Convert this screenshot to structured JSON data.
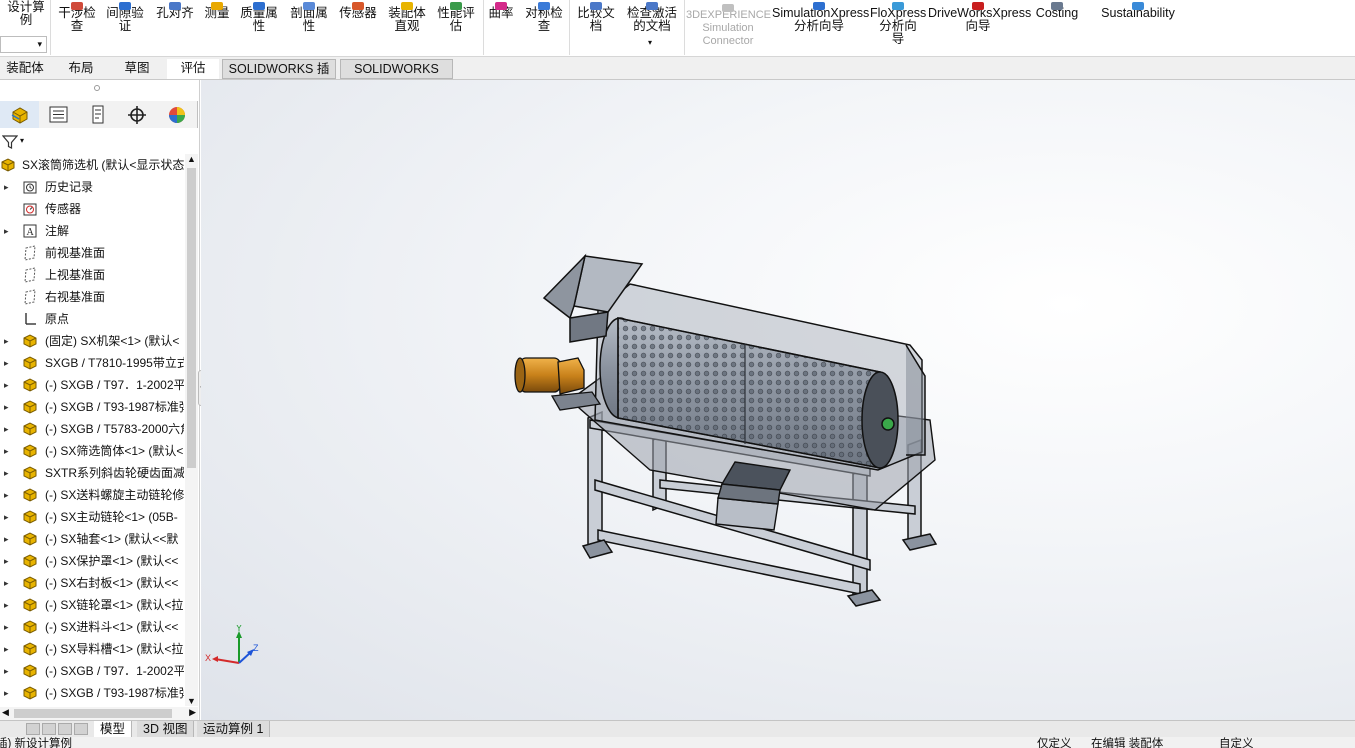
{
  "ribbon": {
    "calc_label": "设计算\n例",
    "buttons": [
      {
        "label": "干涉检\n查"
      },
      {
        "label": "间隙验\n证"
      },
      {
        "label": "孔对齐"
      },
      {
        "label": "测量"
      },
      {
        "label": "质量属\n性"
      },
      {
        "label": "剖面属\n性"
      },
      {
        "label": "传感器"
      },
      {
        "label": "装配体\n直观"
      },
      {
        "label": "性能评\n估"
      },
      {
        "label": "曲率"
      },
      {
        "label": "对称检\n查"
      },
      {
        "label": "比较文\n档"
      },
      {
        "label": "检查激活\n的文档"
      },
      {
        "label": "3DEXPERIENCE\nSimulation\nConnector"
      },
      {
        "label": "SimulationXpress\n分析向导"
      },
      {
        "label": "FloXpress\n分析向\n导"
      },
      {
        "label": "DriveWorksXpress\n向导"
      },
      {
        "label": "Costing"
      },
      {
        "label": "Sustainability"
      }
    ]
  },
  "tabs": [
    "装配体",
    "布局",
    "草图",
    "评估",
    "SOLIDWORKS 插件",
    "SOLIDWORKS MBD"
  ],
  "active_tab": "评估",
  "hud_icons": [
    "zoom-to-fit-icon",
    "zoom-to-area-icon",
    "previous-view-icon",
    "section-view-icon",
    "dynamic-annotation-icon",
    "view-orientation-icon",
    "display-style-icon",
    "hide-show-icon",
    "edit-appearance-icon",
    "scene-icon",
    "view-settings-icon"
  ],
  "feature_tree": {
    "root": "SX滚筒筛选机 (默认<显示状态",
    "items": [
      {
        "label": "历史记录",
        "icon": "history-icon",
        "expandable": true
      },
      {
        "label": "传感器",
        "icon": "sensor-icon",
        "expandable": false
      },
      {
        "label": "注解",
        "icon": "annotation-icon",
        "expandable": true
      },
      {
        "label": "前视基准面",
        "icon": "plane-icon",
        "expandable": false
      },
      {
        "label": "上视基准面",
        "icon": "plane-icon",
        "expandable": false
      },
      {
        "label": "右视基准面",
        "icon": "plane-icon",
        "expandable": false
      },
      {
        "label": "原点",
        "icon": "origin-icon",
        "expandable": false
      },
      {
        "label": "(固定) SX机架<1> (默认<",
        "icon": "part-icon",
        "expandable": true
      },
      {
        "label": "SXGB / T7810-1995带立式",
        "icon": "part-icon",
        "expandable": true
      },
      {
        "label": "(-) SXGB / T97．1-2002平",
        "icon": "part-icon",
        "expandable": true
      },
      {
        "label": "(-) SXGB / T93-1987标准弹",
        "icon": "part-icon",
        "expandable": true
      },
      {
        "label": "(-) SXGB / T5783-2000六角",
        "icon": "part-icon",
        "expandable": true
      },
      {
        "label": "(-) SX筛选筒体<1> (默认<",
        "icon": "part-icon",
        "expandable": true
      },
      {
        "label": "SXTR系列斜齿轮硬齿面减速",
        "icon": "part-icon",
        "expandable": true
      },
      {
        "label": "(-) SX送料螺旋主动链轮修",
        "icon": "part-icon",
        "expandable": true
      },
      {
        "label": "(-) SX主动链轮<1> (05B-",
        "icon": "part-icon",
        "expandable": true
      },
      {
        "label": "(-) SX轴套<1> (默认<<默",
        "icon": "part-icon",
        "expandable": true
      },
      {
        "label": "(-) SX保护罩<1> (默认<<",
        "icon": "part-icon",
        "expandable": true
      },
      {
        "label": "(-) SX右封板<1> (默认<<",
        "icon": "part-icon",
        "expandable": true
      },
      {
        "label": "(-) SX链轮罩<1> (默认<拉",
        "icon": "part-icon",
        "expandable": true
      },
      {
        "label": "(-) SX进料斗<1> (默认<<",
        "icon": "part-icon",
        "expandable": true
      },
      {
        "label": "(-) SX导料槽<1> (默认<拉",
        "icon": "part-icon",
        "expandable": true
      },
      {
        "label": "(-) SXGB / T97．1-2002平",
        "icon": "part-icon",
        "expandable": true
      },
      {
        "label": "(-) SXGB / T93-1987标准弹",
        "icon": "part-icon",
        "expandable": true
      }
    ]
  },
  "triad": {
    "x": "X",
    "y": "Y",
    "z": "Z"
  },
  "bottom_tabs": [
    "模型",
    "3D 视图",
    "运动算例 1"
  ],
  "active_bottom_tab": "模型",
  "status": {
    "left": "插) 新设计算例",
    "s1": "仅定义",
    "s2": "在编辑 装配体",
    "s3": "自定义"
  },
  "colors": {
    "accent": "#0066b3",
    "part_yellow": "#e8b400",
    "motor_orange": "#c8811a"
  }
}
